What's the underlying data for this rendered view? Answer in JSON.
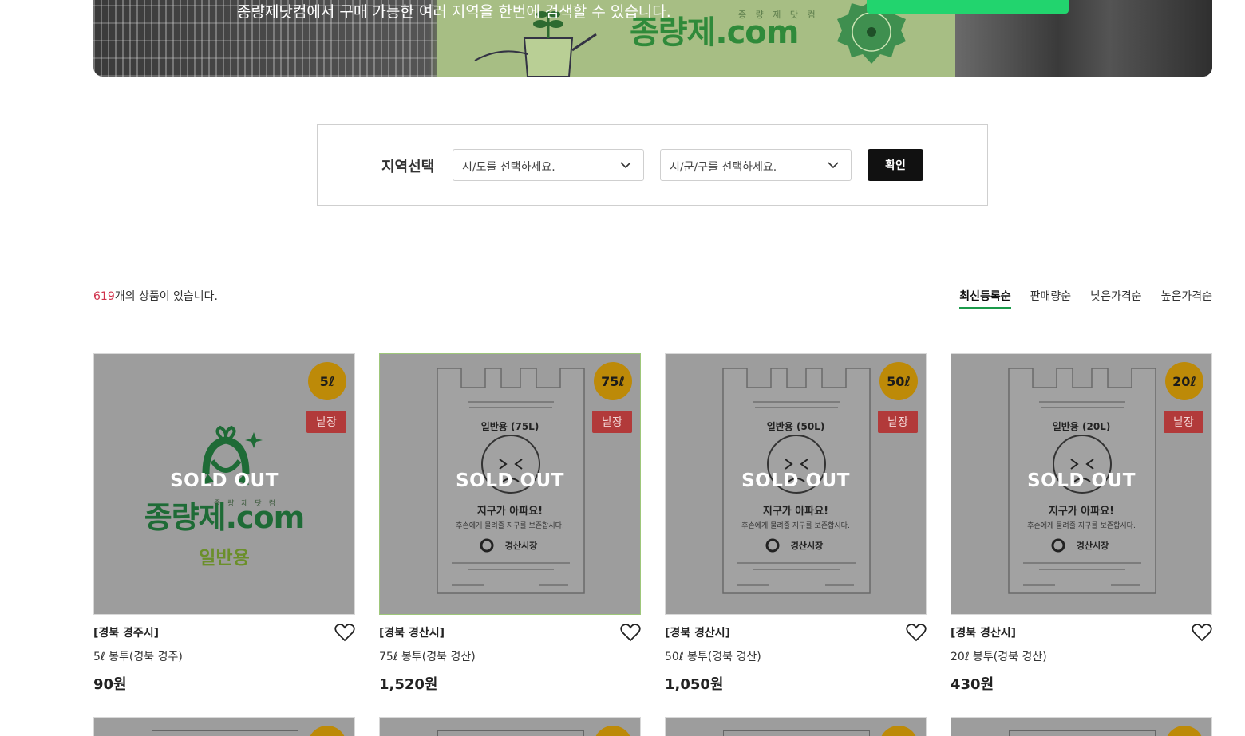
{
  "banner": {
    "caption": "종량제닷컴에서 구매 가능한 여러 지역을 한번에 검색할 수 있습니다.",
    "logo_text": "종량제.com",
    "logo_sub": "종 량 제 닷 컴"
  },
  "region_search": {
    "label": "지역선택",
    "province_placeholder": "시/도를 선택하세요.",
    "city_placeholder": "시/군/구를 선택하세요.",
    "confirm_label": "확인"
  },
  "product_count": {
    "number": "619",
    "suffix": "개의 상품이 있습니다."
  },
  "sort_options": {
    "latest": "최신등록순",
    "sales": "판매량순",
    "low_price": "낮은가격순",
    "high_price": "높은가격순",
    "active": "최신등록순"
  },
  "products": [
    {
      "volume": "5ℓ",
      "tag": "낱장",
      "status": "SOLD OUT",
      "region": "[경북 경주시]",
      "name": "5ℓ 봉투(경북 경주)",
      "price": "90원",
      "image_logo": "종량제.com",
      "image_logo_sub": "종 량 제 닷 컴",
      "image_type": "일반용"
    },
    {
      "volume": "75ℓ",
      "tag": "낱장",
      "status": "SOLD OUT",
      "region": "[경북 경산시]",
      "name": "75ℓ 봉투(경북 경산)",
      "price": "1,520원",
      "bag_title": "일반용 (75L)",
      "bag_slogan": "지구가 아파요!",
      "bag_sub": "후손에게 물려줄 지구를 보존합시다.",
      "bag_city": "경산시장"
    },
    {
      "volume": "50ℓ",
      "tag": "낱장",
      "status": "SOLD OUT",
      "region": "[경북 경산시]",
      "name": "50ℓ 봉투(경북 경산)",
      "price": "1,050원",
      "bag_title": "일반용 (50L)",
      "bag_slogan": "지구가 아파요!",
      "bag_sub": "후손에게 물려줄 지구를 보존합시다.",
      "bag_city": "경산시장"
    },
    {
      "volume": "20ℓ",
      "tag": "낱장",
      "status": "SOLD OUT",
      "region": "[경북 경산시]",
      "name": "20ℓ 봉투(경북 경산)",
      "price": "430원",
      "bag_title": "일반용 (20L)",
      "bag_slogan": "지구가 아파요!",
      "bag_sub": "후손에게 물려줄 지구를 보존합시다.",
      "bag_city": "경산시장"
    }
  ],
  "colors": {
    "accent_green": "#1a9a4a",
    "count_red": "#d0304a",
    "cta_green": "#22d46e",
    "volume_badge": "#bd8a08",
    "tag_red": "#b23a3a"
  }
}
